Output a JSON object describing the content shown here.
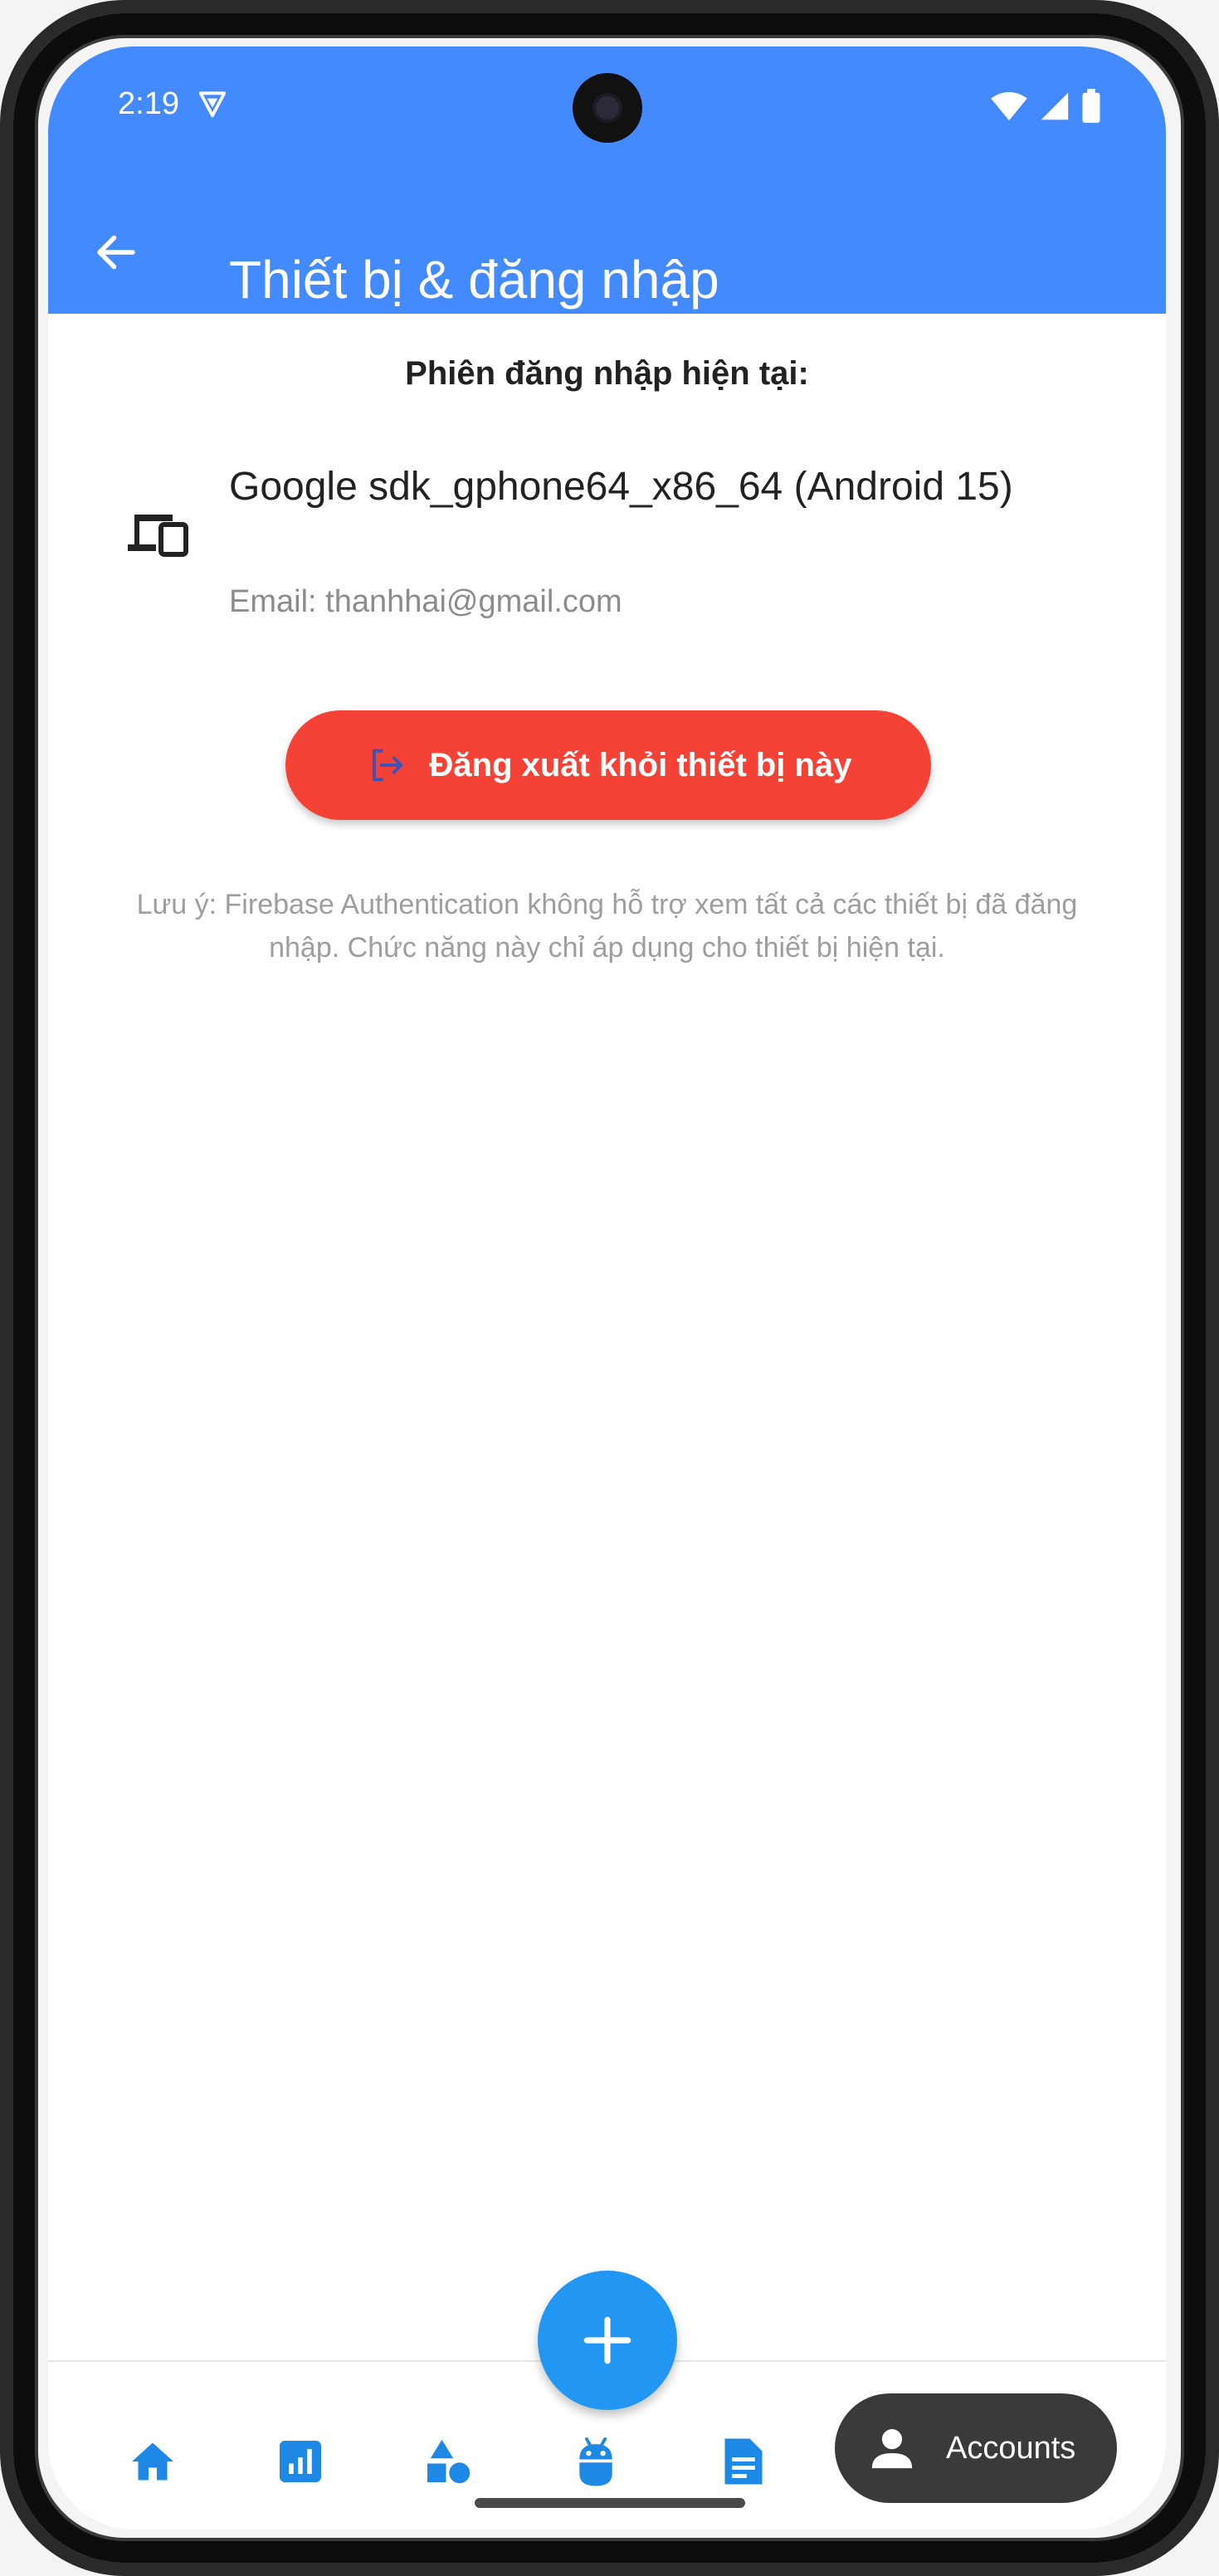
{
  "status_bar": {
    "time": "2:19"
  },
  "app_bar": {
    "title": "Thiết bị & đăng nhập"
  },
  "session": {
    "heading": "Phiên đăng nhập hiện tại:",
    "device_name": "Google sdk_gphone64_x86_64 (Android 15)",
    "email": "Email: thanhhai@gmail.com"
  },
  "logout_button": {
    "label": "Đăng xuất khỏi thiết bị này"
  },
  "note": "Lưu ý: Firebase Authentication không hỗ trợ xem tất cả các thiết bị đã đăng nhập. Chức năng này chỉ áp dụng cho thiết bị hiện tại.",
  "bottom_nav": {
    "items": [
      {
        "icon": "home-icon"
      },
      {
        "icon": "bar-chart-icon"
      },
      {
        "icon": "shapes-icon"
      },
      {
        "icon": "android-icon"
      },
      {
        "icon": "document-icon"
      }
    ],
    "accounts_label": "Accounts"
  },
  "colors": {
    "app_bar": "#448AFF",
    "logout": "#F44336",
    "nav_icon": "#1E88E5",
    "fab": "#2196F3",
    "accounts_pill": "#3a3a3a"
  }
}
